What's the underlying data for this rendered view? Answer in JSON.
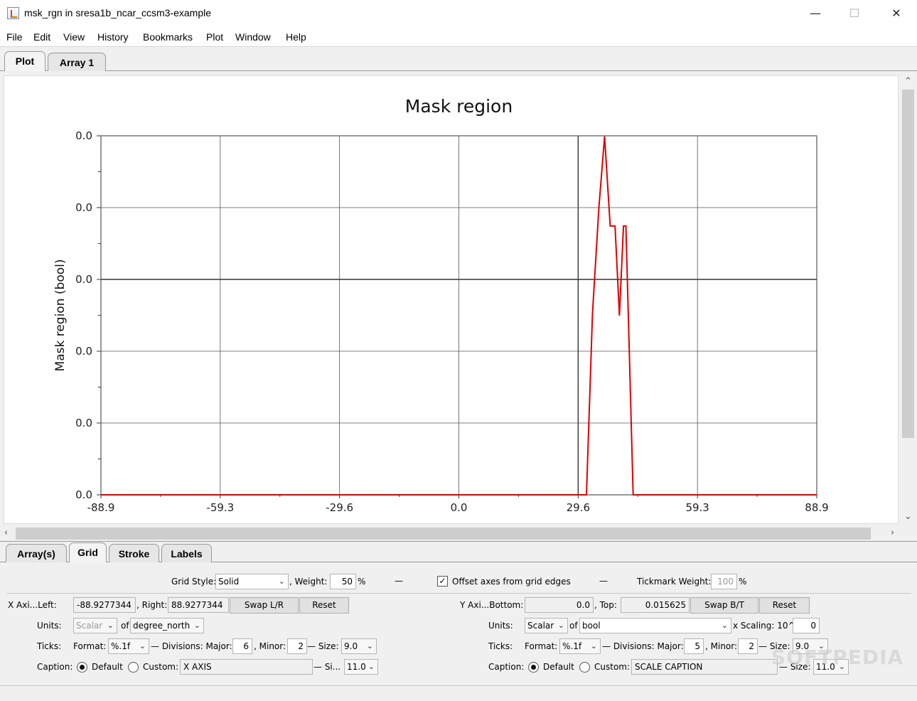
{
  "window": {
    "title": "msk_rgn in sresa1b_ncar_ccsm3-example"
  },
  "menu": [
    "File",
    "Edit",
    "View",
    "History",
    "Bookmarks",
    "Plot",
    "Window",
    "Help"
  ],
  "top_tabs": [
    "Plot",
    "Array 1"
  ],
  "bottom_tabs": [
    "Array(s)",
    "Grid",
    "Stroke",
    "Labels"
  ],
  "chart_data": {
    "type": "line",
    "title": "Mask region",
    "ylabel": "Mask region (bool)",
    "xlabel": "",
    "x_ticks": [
      "-88.9",
      "-59.3",
      "-29.6",
      "0.0",
      "29.6",
      "59.3",
      "88.9"
    ],
    "y_ticks": [
      "0.0",
      "0.0",
      "0.0",
      "0.0",
      "0.0",
      "0.0"
    ],
    "xlim": [
      -88.9277344,
      88.9277344
    ],
    "ylim": [
      0.0,
      0.015625
    ],
    "grid": true,
    "series": [
      {
        "color": "#dd0000",
        "x": [
          -88.9,
          29.6,
          31.7,
          33.2,
          34.8,
          36.2,
          37.6,
          38.8,
          39.9,
          40.9,
          41.5,
          43.3,
          88.9
        ],
        "y": [
          0.0,
          0.0,
          0.0,
          0.0079,
          0.0125,
          0.0156,
          0.0117,
          0.0117,
          0.0078,
          0.0117,
          0.0117,
          0.0,
          0.0
        ]
      }
    ]
  },
  "grid_panel": {
    "grid_style_label": "Grid Style:",
    "grid_style": "Solid",
    "weight_label": ", Weight:",
    "weight": "50",
    "pct": "%",
    "offset_label": "Offset axes from grid edges",
    "tick_weight_label": "Tickmark Weight:",
    "tick_weight": "100",
    "x_axis": {
      "label": "X Axi...Left:",
      "left": "-88.9277344",
      "right_label": ", Right:",
      "right": "88.9277344",
      "swap": "Swap L/R",
      "reset": "Reset",
      "units_label": "Units:",
      "units": "Scalar",
      "of_label": "of",
      "of_value": "degree_north",
      "ticks_label": "Ticks:",
      "format_label": "Format:",
      "format": "%.1f",
      "divisions_label": "— Divisions: Major:",
      "major": "6",
      "minor_label": ", Minor:",
      "minor": "2",
      "size_label": "— Size:",
      "size": "9.0",
      "caption_label": "Caption:",
      "default_label": "Default",
      "custom_label": "Custom:",
      "custom": "X AXIS",
      "caption_size_label": "— Si...",
      "caption_size": "11.0"
    },
    "y_axis": {
      "label": "Y Axi...Bottom:",
      "bottom": "0.0",
      "top_label": ", Top:",
      "top": "0.015625",
      "swap": "Swap B/T",
      "reset": "Reset",
      "units_label": "Units:",
      "units": "Scalar",
      "of_label": "of",
      "of_value": "bool",
      "scaling_label": "x Scaling: 10^",
      "scaling": "0",
      "ticks_label": "Ticks:",
      "format_label": "Format:",
      "format": "%.1f",
      "divisions_label": "— Divisions: Major:",
      "major": "5",
      "minor_label": ", Minor:",
      "minor": "2",
      "size_label": "— Size:",
      "size": "9.0",
      "caption_label": "Caption:",
      "default_label": "Default",
      "custom_label": "Custom:",
      "custom": "SCALE CAPTION",
      "caption_size_label": "— Size:",
      "caption_size": "11.0"
    }
  },
  "watermark": "SOFTPEDIA"
}
